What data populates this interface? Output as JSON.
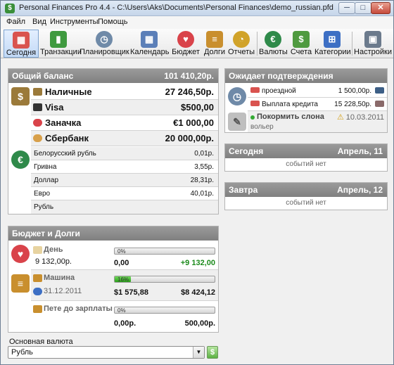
{
  "window": {
    "title": "Personal Finances Pro 4.4 - C:\\Users\\Aks\\Documents\\Personal Finances\\demo_russian.pfd",
    "min": "─",
    "max": "□",
    "close": "✕"
  },
  "menu": [
    "Файл",
    "Вид",
    "Инструменты",
    "Помощь"
  ],
  "toolbar": {
    "items": [
      {
        "label": "Сегодня",
        "icon": "calendar-today-icon",
        "color": "#d9534f"
      },
      {
        "label": "Транзакции",
        "icon": "book-icon",
        "color": "#3f9a3f"
      },
      {
        "label": "Планировщик",
        "icon": "clock-icon",
        "color": "#6f8aa8"
      },
      {
        "label": "Календарь",
        "icon": "calendar-icon",
        "color": "#5b7fb8"
      },
      {
        "label": "Бюджет",
        "icon": "piggy-bank-icon",
        "color": "#d9434a"
      },
      {
        "label": "Долги",
        "icon": "money-stack-icon",
        "color": "#c98f2e"
      },
      {
        "label": "Отчеты",
        "icon": "pie-chart-icon",
        "color": "#d1a32a"
      },
      {
        "label": "Валюты",
        "icon": "currency-exchange-icon",
        "color": "#2f8a4a"
      },
      {
        "label": "Счета",
        "icon": "banknotes-icon",
        "color": "#4f9a3f"
      },
      {
        "label": "Категории",
        "icon": "categories-tree-icon",
        "color": "#3d6fc4"
      },
      {
        "label": "Настройки",
        "icon": "settings-computer-icon",
        "color": "#6b7a8c"
      }
    ],
    "active": "Сегодня"
  },
  "balance": {
    "title": "Общий баланс",
    "total": "101 410,20р.",
    "accounts": [
      {
        "name": "Наличные",
        "value": "27 246,50р.",
        "icon": "wallet-icon",
        "color": "#9b7a3a"
      },
      {
        "name": "Visa",
        "value": "$500,00",
        "icon": "credit-card-icon",
        "color": "#333333"
      },
      {
        "name": "Заначка",
        "value": "€1 000,00",
        "icon": "piggy-bank-icon",
        "color": "#d9434a"
      },
      {
        "name": "Сбербанк",
        "value": "20 000,00р.",
        "icon": "coin-icon",
        "color": "#d8a04a"
      }
    ],
    "rates": [
      {
        "name": "Белорусский рубль",
        "value": "0,01р."
      },
      {
        "name": "Гривна",
        "value": "3,55р."
      },
      {
        "name": "Доллар",
        "value": "28,31р."
      },
      {
        "name": "Евро",
        "value": "40,01р."
      },
      {
        "name": "Рубль",
        "value": ""
      }
    ]
  },
  "budget": {
    "title": "Бюджет и Долги",
    "items": [
      {
        "name": "День",
        "amount": "9 132,00р.",
        "pct": "0%",
        "progress": 0,
        "spent": "0,00",
        "remain": "+9 132,00",
        "icon": "envelope-icon"
      },
      {
        "name": "Машина",
        "date": "31.12.2011",
        "pct": "16%",
        "progress": 0.16,
        "spent": "$1 575,88",
        "remain": "$8 424,12",
        "icon": "money-stack-icon"
      },
      {
        "name": "Пете до зарплаты",
        "pct": "0%",
        "progress": 0,
        "spent": "0,00р.",
        "remain": "500,00р.",
        "icon": "money-stack-icon"
      }
    ]
  },
  "base_currency": {
    "label": "Основная валюта",
    "value": "Рубль"
  },
  "pending": {
    "title": "Ожидает подтверждения",
    "rows": [
      {
        "name": "проездной",
        "value": "1 500,00р."
      },
      {
        "name": "Выплата кредита",
        "value": "15 228,50р."
      }
    ],
    "task": {
      "name": "Покормить слона",
      "date": "10.03.2011",
      "note": "вольер"
    }
  },
  "today": {
    "title": "Сегодня",
    "date": "Апрель, 11",
    "empty": "событий нет"
  },
  "tomorrow": {
    "title": "Завтра",
    "date": "Апрель, 12",
    "empty": "событий нет"
  }
}
